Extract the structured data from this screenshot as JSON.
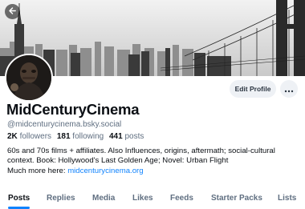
{
  "profile": {
    "display_name": "MidCenturyCinema",
    "handle": "@midcenturycinema.bsky.social",
    "edit_profile_label": "Edit Profile"
  },
  "stats": {
    "followers_count": "2K",
    "followers_label": "followers",
    "following_count": "181",
    "following_label": "following",
    "posts_count": "441",
    "posts_label": "posts"
  },
  "bio": {
    "line1": "60s and 70s films + affiliates. Also Influences, origins, aftermath; social-cultural",
    "line2": "context. Book: Hollywood's Last Golden Age; Novel: Urban Flight",
    "line3_prefix": "Much more here: ",
    "link": "midcenturycinema.org"
  },
  "tabs": [
    {
      "label": "Posts",
      "active": true
    },
    {
      "label": "Replies",
      "active": false
    },
    {
      "label": "Media",
      "active": false
    },
    {
      "label": "Likes",
      "active": false
    },
    {
      "label": "Feeds",
      "active": false
    },
    {
      "label": "Starter Packs",
      "active": false
    },
    {
      "label": "Lists",
      "active": false
    }
  ],
  "icons": {
    "back": "arrow-left-icon",
    "more": "ellipsis-icon"
  },
  "colors": {
    "accent": "#1083fe",
    "muted_text": "#5f6e80",
    "button_bg": "#eef1f5"
  }
}
